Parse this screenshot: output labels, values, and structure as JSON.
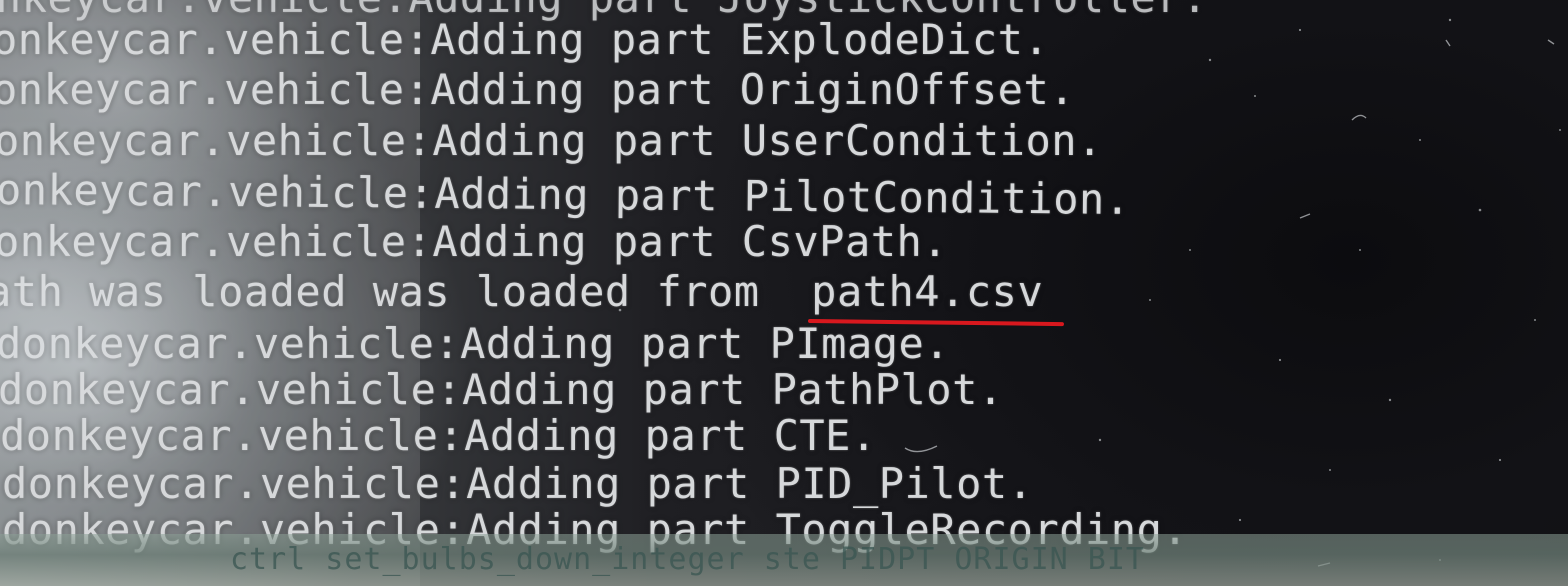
{
  "terminal": {
    "lines": [
      "onkeycar.vehicle:Adding part JoystickController.",
      "onkeycar.vehicle:Adding part ExplodeDict.",
      "onkeycar.vehicle:Adding part OriginOffset.",
      "onkeycar.vehicle:Adding part UserCondition.",
      "onkeycar.vehicle:Adding part PilotCondition.",
      "onkeycar.vehicle:Adding part CsvPath.",
      "ath was loaded was loaded from  path4.csv",
      "donkeycar.vehicle:Adding part PImage.",
      "donkeycar.vehicle:Adding part PathPlot.",
      "donkeycar.vehicle:Adding part CTE.",
      "donkeycar.vehicle:Adding part PID_Pilot.",
      "donkeycar.vehicle:Adding part ToggleRecording."
    ],
    "highlighted_text": "path4.csv",
    "bottom_garbled": "ctrl set_bulbs_down_integer ste PIDPT ORIGIN BIT"
  },
  "colors": {
    "text": "#d6d8da",
    "background": "#141416",
    "annotation_underline": "#d8181e"
  }
}
